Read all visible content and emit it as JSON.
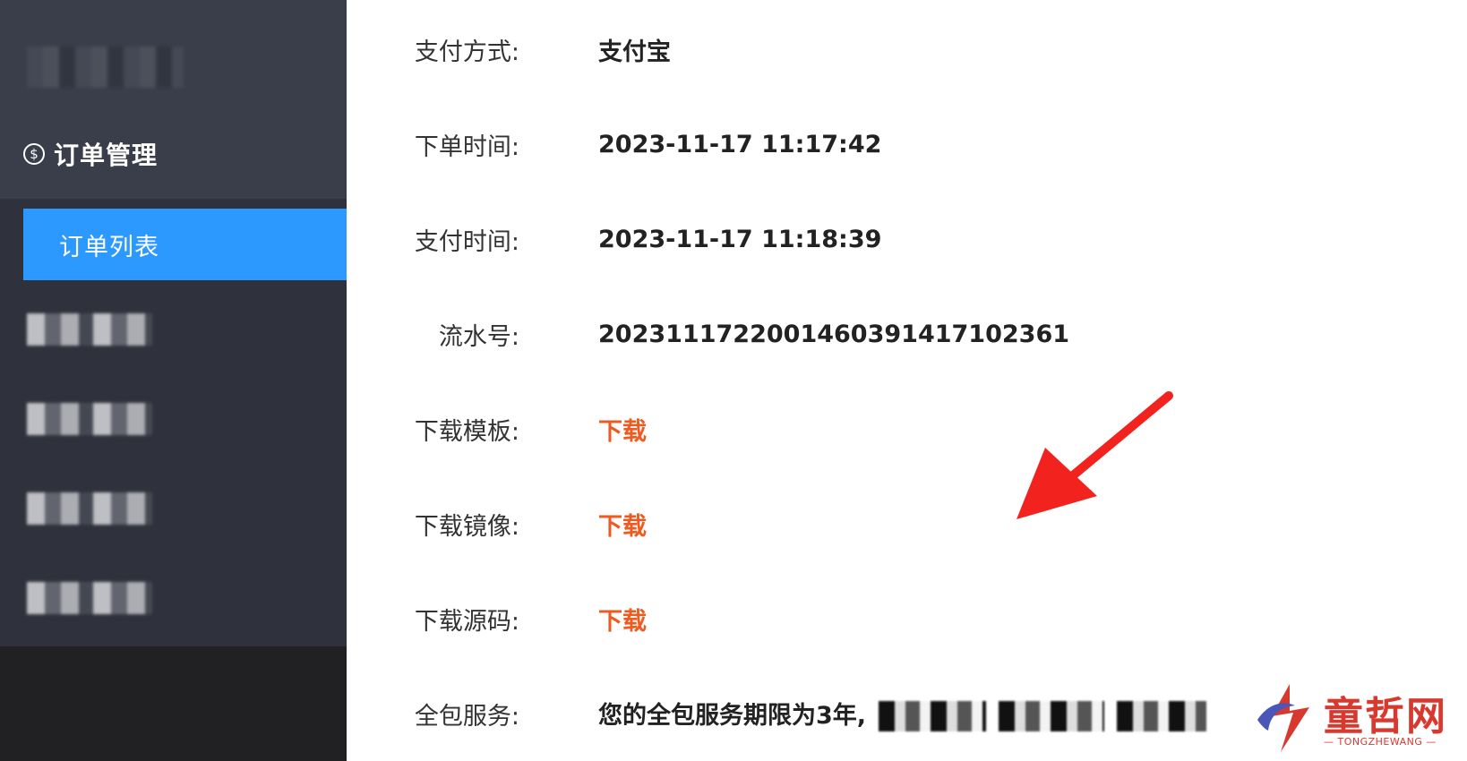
{
  "sidebar": {
    "group_label": "订单管理",
    "group_icon": "dollar-circle-icon",
    "active_item_label": "订单列表",
    "active_color": "#2b99ff"
  },
  "details": {
    "rows": [
      {
        "label": "支付方式:",
        "value": "支付宝"
      },
      {
        "label": "下单时间:",
        "value": "2023-11-17 11:17:42"
      },
      {
        "label": "支付时间:",
        "value": "2023-11-17 11:18:39"
      },
      {
        "label": "流水号:",
        "value": "2023111722001460391417102361"
      },
      {
        "label": "下载模板:",
        "value": "下载"
      },
      {
        "label": "下载镜像:",
        "value": "下载"
      },
      {
        "label": "下载源码:",
        "value": "下载"
      },
      {
        "label": "全包服务:",
        "value": "您的全包服务期限为3年,"
      }
    ],
    "link_color": "#ee5a1f"
  },
  "watermark": {
    "name": "童哲网",
    "sub": "— TONGZHEWANG —"
  }
}
